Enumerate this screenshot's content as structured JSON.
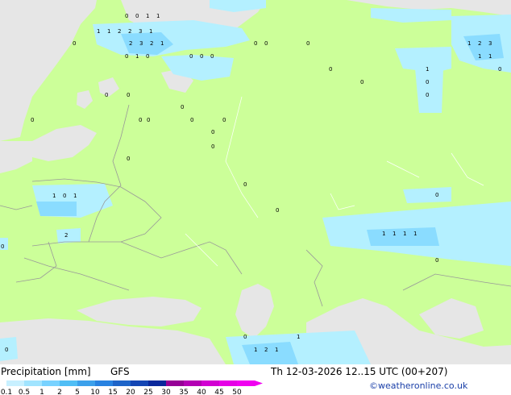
{
  "legend": {
    "title": "Precipitation [mm]",
    "model": "GFS",
    "ticks": [
      "0.1",
      "0.5",
      "1",
      "2",
      "5",
      "10",
      "15",
      "20",
      "25",
      "30",
      "35",
      "40",
      "45",
      "50"
    ],
    "colors": [
      "#c8f0ff",
      "#a0e4ff",
      "#78d2ff",
      "#50bef5",
      "#3ca0eb",
      "#2882e1",
      "#1e64c8",
      "#1446b4",
      "#0a289b",
      "#960096",
      "#b400b4",
      "#d200d2",
      "#e600e6",
      "#f000f0"
    ]
  },
  "valid_time": "Th 12-03-2026 12..15 UTC (00+207)",
  "credit": "©weatheronline.co.uk",
  "map_colors": {
    "land": "#ccff99",
    "sea": "#e6e6e6",
    "no_data_land": "#e6e6e6",
    "precip_light": "#b4f0ff",
    "precip_mid": "#8adcff",
    "border": "#999999"
  },
  "values": [
    "0",
    "0",
    "1",
    "1",
    "2",
    "3",
    "1",
    "0",
    "0",
    "0",
    "0",
    "1"
  ]
}
